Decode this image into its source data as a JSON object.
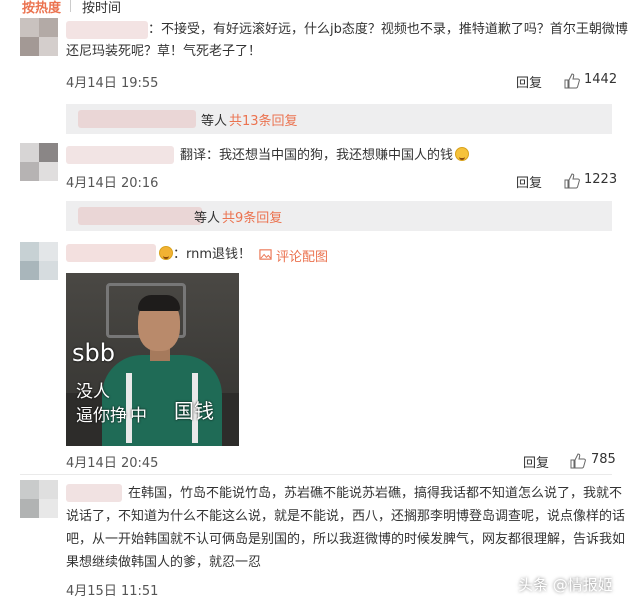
{
  "sort_bar": {
    "hot": "按热度",
    "time": "按时间"
  },
  "comments": [
    {
      "text_line1": "：不接受，有好远滚好远，什么jb态度？视频也不录，推特道歉了吗？首尔王朝微博",
      "text_line2": "还尼玛装死呢？草！气死老子了！",
      "time": "4月14日 19:55",
      "reply_label": "回复",
      "likes": "1442"
    },
    {
      "text": "翻译：我还想当中国的狗，我还想赚中国人的钱",
      "time": "4月14日 20:16",
      "reply_label": "回复",
      "likes": "1223"
    },
    {
      "text": "：rnm退钱！",
      "figure_link": "评论配图",
      "time": "4月14日 20:45",
      "reply_label": "回复",
      "likes": "785"
    },
    {
      "text_line1": "在韩国，竹岛不能说竹岛，苏岩礁不能说苏岩礁，搞得我话都不知道怎么说了，我就不",
      "text_line2": "说话了，不知道为什么不能这么说，就是不能说，西八，还搁那李明博登岛调查呢，说点像样的话",
      "text_line3": "吧，从一开始韩国就不认可俩岛是别国的，所以我逛微博的时候发脾气，网友都很理解，告诉我如",
      "text_line4": "果想继续做韩国人的爹，就忍一忍",
      "time": "4月15日 11:51"
    }
  ],
  "reply_summaries": [
    {
      "who": "等人",
      "count": "共13条回复"
    },
    {
      "who": "等人",
      "count": "共9条回复"
    }
  ],
  "meme": {
    "big": "sbb",
    "line1": "没人",
    "line2": "逼你挣",
    "line3": "中",
    "line4": "国钱"
  },
  "watermark": "头条 @情报姬",
  "colors": {
    "accent": "#eb7350",
    "reply_bg": "#eeeeef"
  }
}
